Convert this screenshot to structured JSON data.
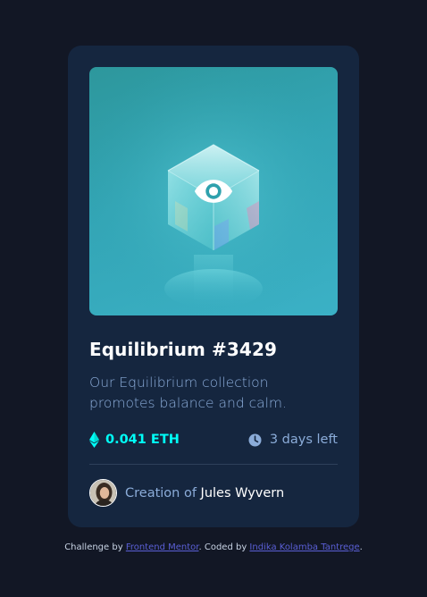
{
  "card": {
    "title": "Equilibrium #3429",
    "description": "Our Equilibrium collection promotes balance and calm.",
    "price": "0.041 ETH",
    "time_left": "3 days left",
    "creator_prefix": "Creation of ",
    "creator_name": "Jules Wyvern"
  },
  "icons": {
    "eth": "ethereum-icon",
    "clock": "clock-icon",
    "view": "eye-icon"
  },
  "footer": {
    "prefix": "Challenge by ",
    "link1": "Frontend Mentor",
    "middle": ". Coded by ",
    "link2": "Indika Kolamba Tantrege",
    "suffix": "."
  },
  "colors": {
    "page_bg": "#121725",
    "card_bg": "#15263f",
    "accent_cyan": "#00fff7",
    "soft_blue": "#8bacd9",
    "white": "#ffffff",
    "link": "#5a5fd6"
  }
}
